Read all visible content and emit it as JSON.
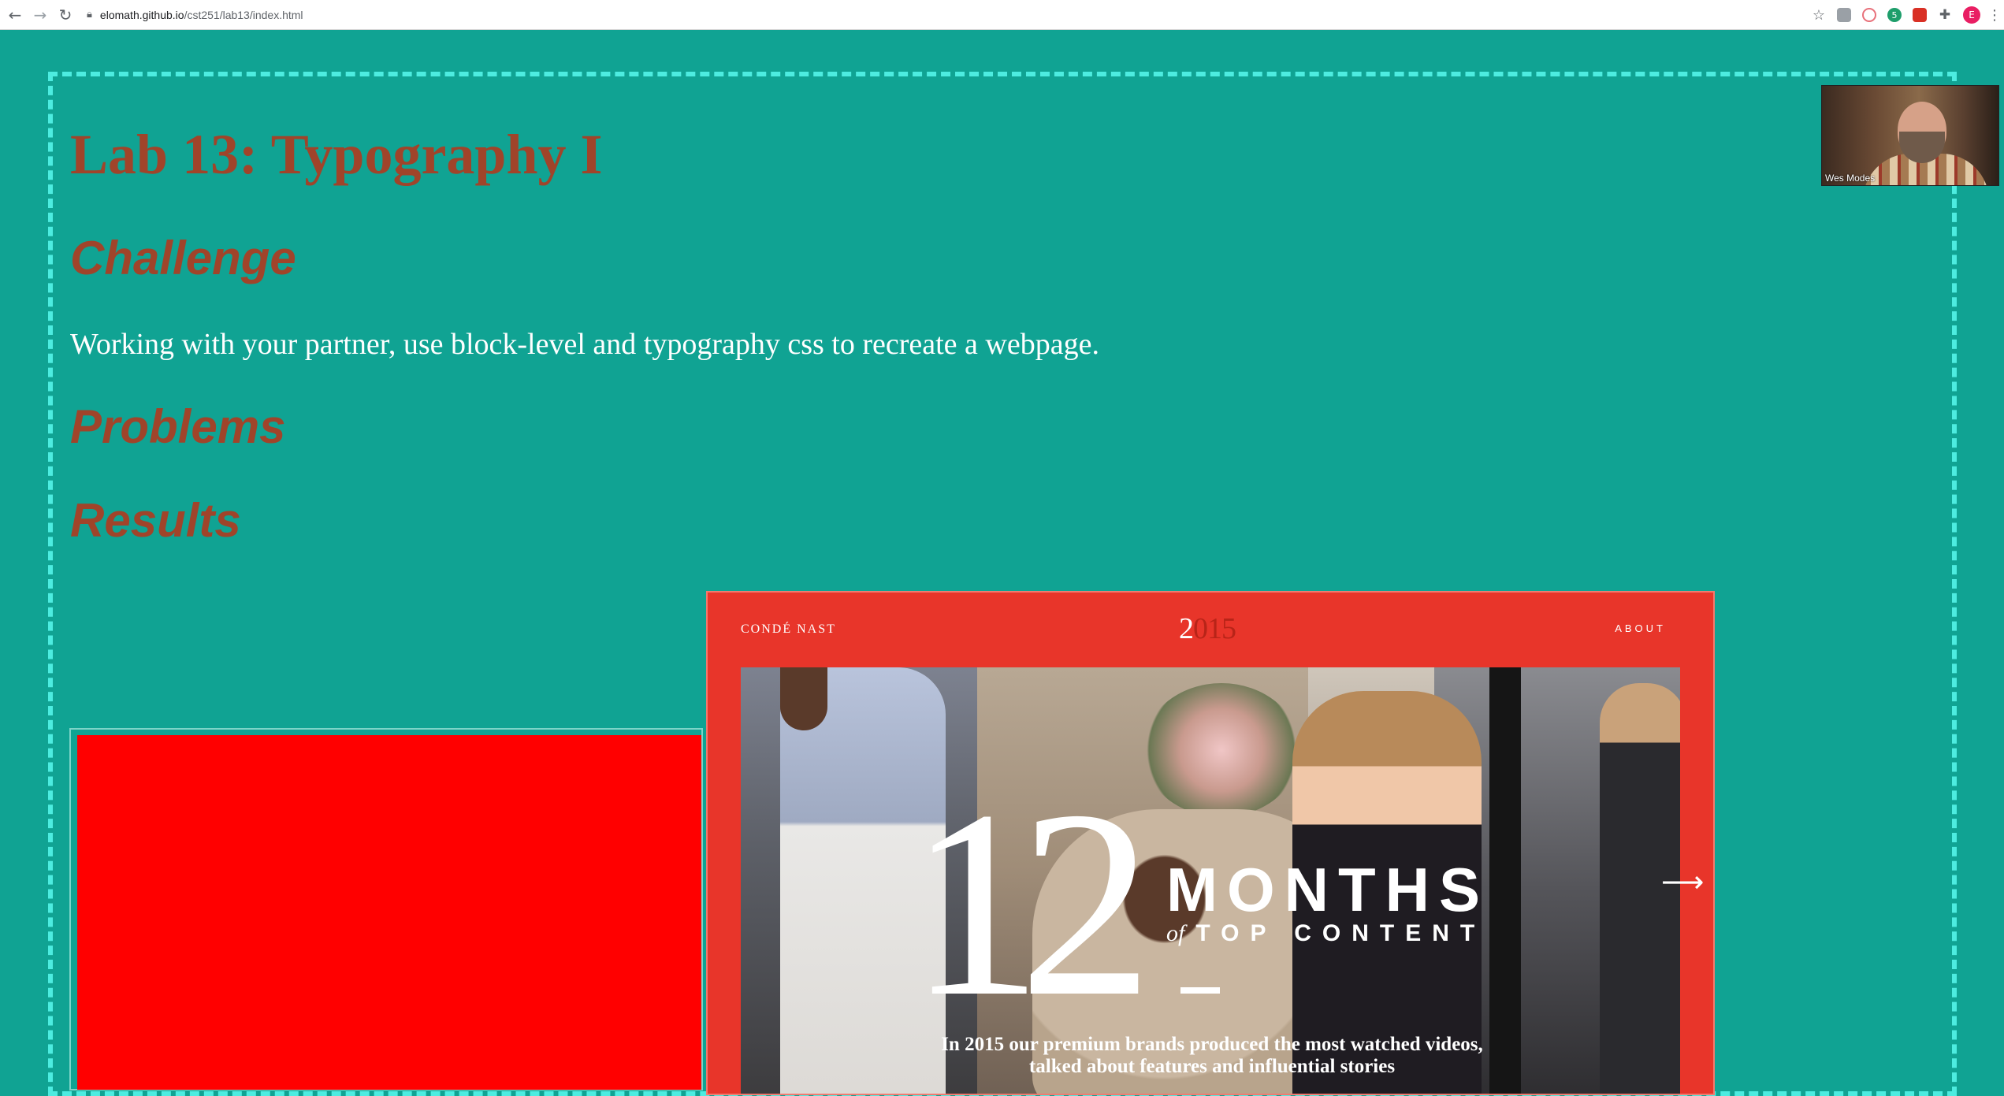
{
  "browser": {
    "url_host": "elomath.github.io",
    "url_path": "/cst251/lab13/index.html",
    "icons": [
      "back-icon",
      "forward-icon",
      "reload-icon",
      "lock-icon",
      "star-icon",
      "puzzle-icon",
      "menu-icon"
    ],
    "profile_initial": "E",
    "badge_count": "5"
  },
  "page": {
    "title": "Lab 13: Typography I",
    "challenge_heading": "Challenge",
    "challenge_text": "Working with your partner, use block-level and typography css to recreate a webpage.",
    "problems_heading": "Problems",
    "results_heading": "Results"
  },
  "conde": {
    "logo": "CONDÉ NAST",
    "year_a": "2",
    "year_b": "015",
    "about": "ABOUT",
    "big_number": "12",
    "months": "MONTHS",
    "of": "of",
    "top_content": "TOP CONTENT",
    "tagline_1": "In 2015 our premium brands produced the most watched videos,",
    "tagline_2": "talked about features and influential stories",
    "arrow": "⟶"
  },
  "video": {
    "name": "Wes Modes"
  },
  "colors": {
    "page_bg": "#10a393",
    "heading": "#a0442a",
    "dashed_border": "#4dece0",
    "red_box": "#ff0000",
    "conde_bg": "#e8352a"
  }
}
